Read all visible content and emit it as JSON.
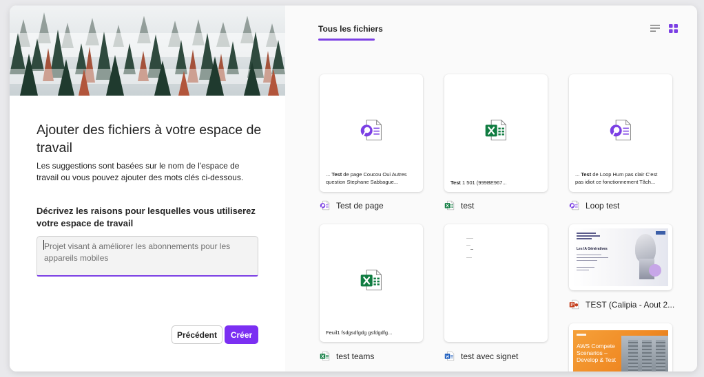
{
  "left": {
    "title": "Ajouter des fichiers à votre espace de travail",
    "subtitle": "Les suggestions sont basées sur le nom de l'espace de travail ou vous pouvez ajouter des mots clés ci-dessous.",
    "field_label": "Décrivez les raisons pour lesquelles vous utiliserez votre espace de travail",
    "field_value": "Projet visant à améliorer les abonnements pour les appareils mobiles",
    "prev_button": "Précédent",
    "create_button": "Créer"
  },
  "right": {
    "tab_label": "Tous les fichiers",
    "files": [
      {
        "name": "Test de page",
        "icon": "loop-icon",
        "snippet_prefix": "... ",
        "snippet_bold": "Test",
        "snippet_rest": " de page Coucou Oui Autres question Stephane Sabbague..."
      },
      {
        "name": "test",
        "icon": "excel-icon",
        "snippet_prefix": "",
        "snippet_bold": "Test",
        "snippet_rest": " 1 501 (999BE967..."
      },
      {
        "name": "Loop test",
        "icon": "loop-icon",
        "snippet_prefix": "... ",
        "snippet_bold": "Test",
        "snippet_rest": " de Loop Hum pas clair C'est pas idiot ce fonctionnement Tâch..."
      },
      {
        "name": "test teams",
        "icon": "excel-icon",
        "snippet_prefix": "",
        "snippet_bold": "",
        "snippet_rest": "Feuil1 fsdgsdfgdg gsfdgdfg..."
      },
      {
        "name": "test avec signet",
        "icon": "word-icon"
      },
      {
        "name": "TEST (Calipia - Aout 2...",
        "icon": "powerpoint-icon",
        "slide_title": "Les IA Génératives"
      },
      {
        "name": "",
        "icon": "powerpoint-icon",
        "slide_title": "AWS Compete Scenarios – Develop & Test"
      }
    ]
  },
  "colors": {
    "accent": "#7b2ff2",
    "excel": "#107c41",
    "word": "#185abd",
    "powerpoint": "#c43e1c",
    "loop": "#7b3fe4"
  }
}
